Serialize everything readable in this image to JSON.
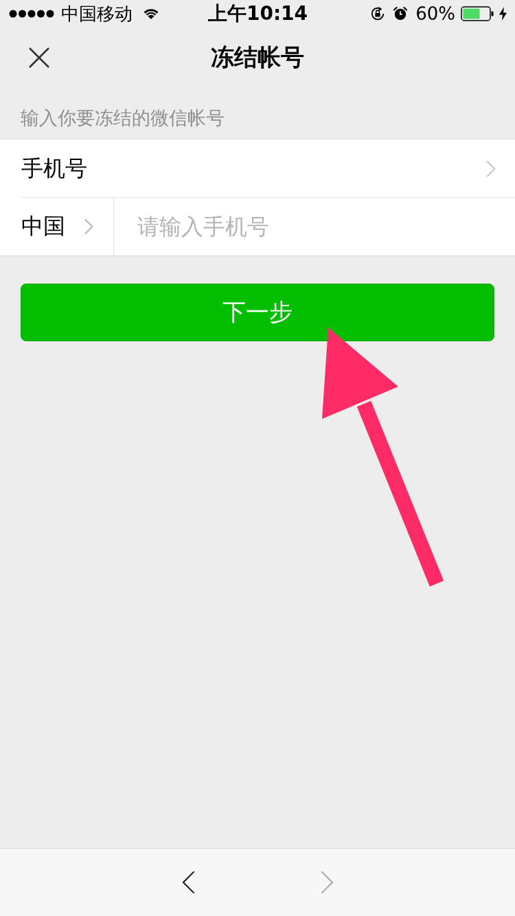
{
  "status_bar": {
    "carrier": "中国移动",
    "time": "上午10:14",
    "battery": "60%"
  },
  "nav": {
    "title": "冻结帐号"
  },
  "section_header": "输入你要冻结的微信帐号",
  "account_type": {
    "label": "手机号"
  },
  "phone": {
    "country": "中国",
    "placeholder": "请输入手机号"
  },
  "next_button": {
    "label": "下一步"
  },
  "toolbar": {
    "buttons": [
      {
        "kind": "back",
        "disabled": false
      },
      {
        "kind": "forward",
        "disabled": true
      }
    ]
  }
}
